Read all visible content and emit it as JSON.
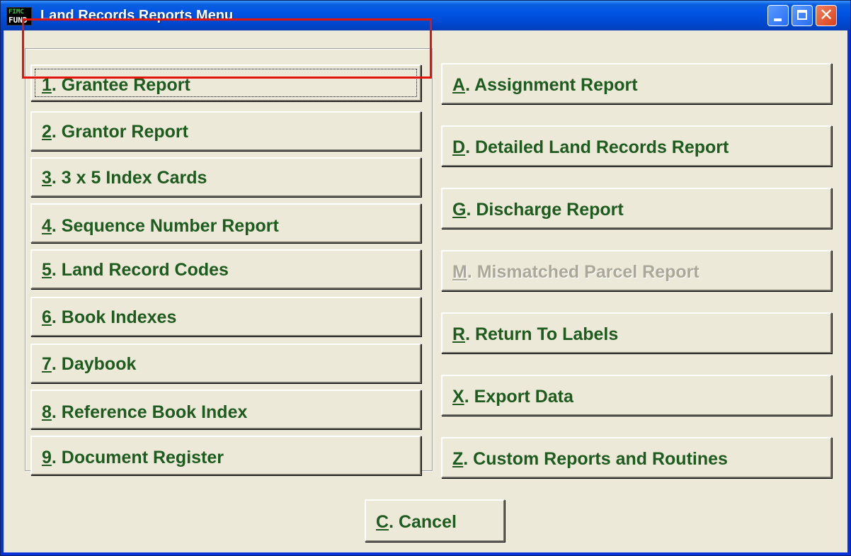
{
  "window": {
    "title": "Land Records Reports Menu",
    "icon_top": "FIMC",
    "icon_bottom": "FUND"
  },
  "left_buttons": [
    {
      "key": "1",
      "rest": ". Grantee Report",
      "enabled": true
    },
    {
      "key": "2",
      "rest": ". Grantor Report",
      "enabled": true
    },
    {
      "key": "3",
      "rest": ". 3 x 5 Index Cards",
      "enabled": true
    },
    {
      "key": "4",
      "rest": ". Sequence Number Report",
      "enabled": true
    },
    {
      "key": "5",
      "rest": ". Land  Record Codes",
      "enabled": true
    },
    {
      "key": "6",
      "rest": ". Book Indexes",
      "enabled": true
    },
    {
      "key": "7",
      "rest": ". Daybook",
      "enabled": true
    },
    {
      "key": "8",
      "rest": ". Reference Book Index",
      "enabled": true
    },
    {
      "key": "9",
      "rest": ". Document Register",
      "enabled": true
    }
  ],
  "right_buttons": [
    {
      "key": "A",
      "rest": ". Assignment Report",
      "enabled": true
    },
    {
      "key": "D",
      "rest": ". Detailed Land Records Report",
      "enabled": true
    },
    {
      "key": "G",
      "rest": ". Discharge Report",
      "enabled": true
    },
    {
      "key": "M",
      "rest": ". Mismatched Parcel Report",
      "enabled": false
    },
    {
      "key": "R",
      "rest": ". Return To Labels",
      "enabled": true
    },
    {
      "key": "X",
      "rest": ". Export Data",
      "enabled": true
    },
    {
      "key": "Z",
      "rest": ". Custom Reports and Routines",
      "enabled": true
    }
  ],
  "cancel": {
    "key": "C",
    "rest": ". Cancel"
  },
  "colors": {
    "label": "#1e5b1e",
    "disabled": "#aca899",
    "highlight": "#e3140c"
  }
}
